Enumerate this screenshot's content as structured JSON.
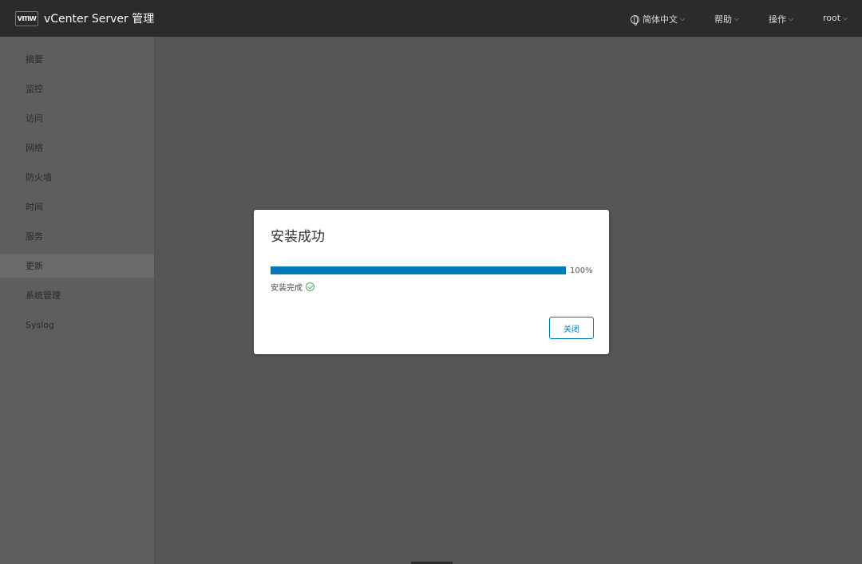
{
  "header": {
    "logo_text": "vmw",
    "title": "vCenter Server 管理",
    "menus": {
      "language": "简体中文",
      "help": "帮助",
      "actions": "操作",
      "user": "root"
    },
    "icons": {
      "language": "globe-icon",
      "dropdown": "chevron-down-icon"
    }
  },
  "sidebar": {
    "items": [
      {
        "label": "摘要"
      },
      {
        "label": "监控"
      },
      {
        "label": "访问"
      },
      {
        "label": "网络"
      },
      {
        "label": "防火墙"
      },
      {
        "label": "时间"
      },
      {
        "label": "服务"
      },
      {
        "label": "更新"
      },
      {
        "label": "系统管理"
      },
      {
        "label": "Syslog"
      }
    ],
    "active_item": "更新"
  },
  "dialog": {
    "title": "安装成功",
    "progress": {
      "value": 100,
      "label": "100%"
    },
    "status_text": "安装完成",
    "status_icon": "check-circle-icon",
    "close_label": "关闭"
  },
  "colors": {
    "header_bg": "#2b2b2b",
    "accent": "#0079b8",
    "success": "#4caf50"
  }
}
